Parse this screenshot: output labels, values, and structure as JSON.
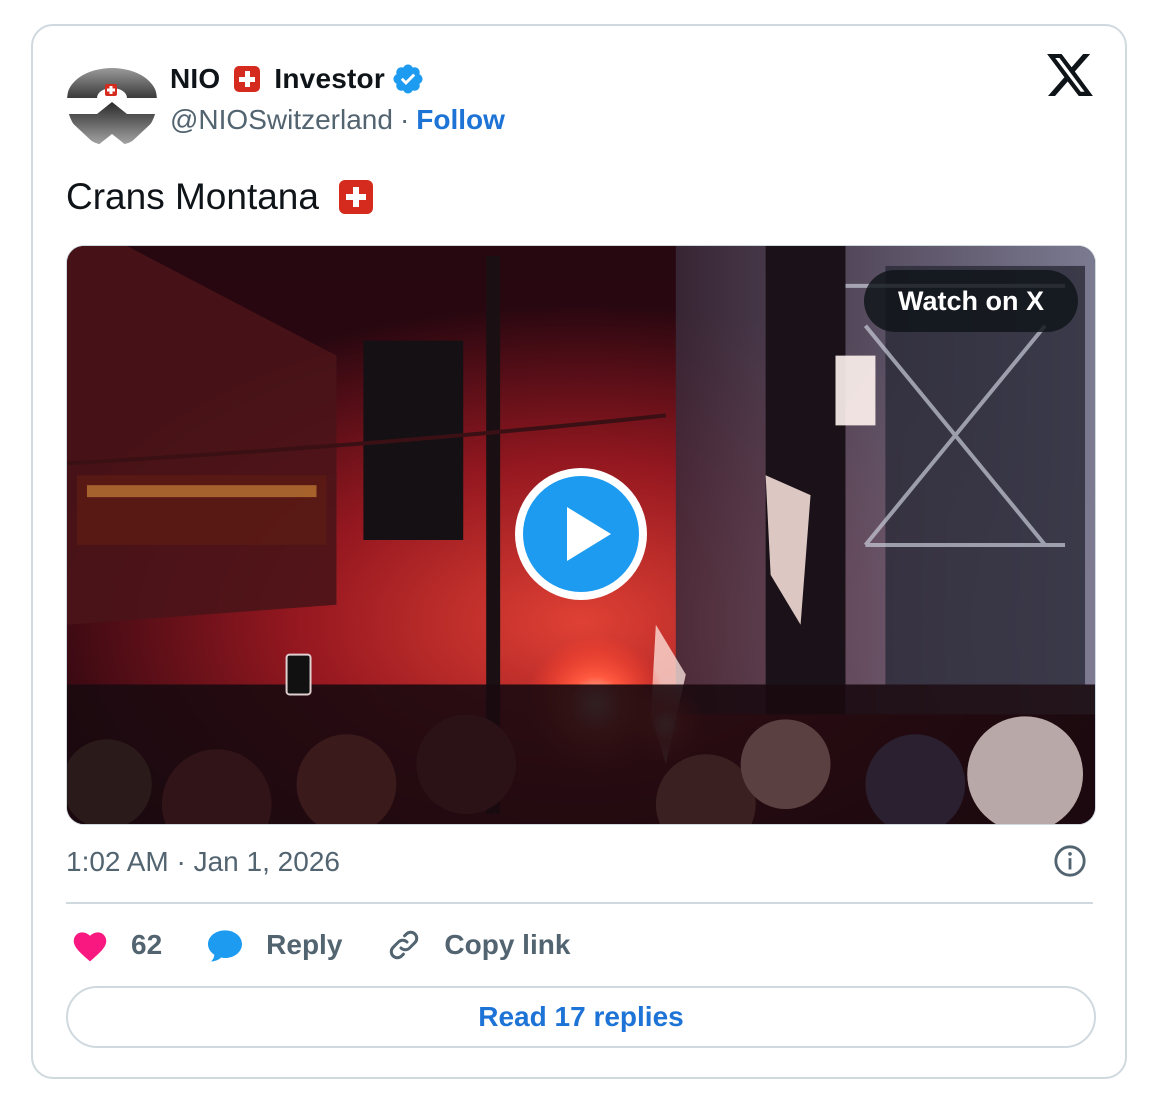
{
  "author": {
    "display_name_part1": "NIO",
    "display_name_part2": "Investor",
    "handle": "@NIOSwitzerland",
    "separator": "·",
    "follow_label": "Follow"
  },
  "tweet": {
    "text": "Crans Montana",
    "timestamp": "1:02 AM · Jan 1, 2026"
  },
  "media": {
    "watch_label": "Watch on X"
  },
  "actions": {
    "likes_count": "62",
    "reply_label": "Reply",
    "copy_link_label": "Copy link"
  },
  "read_replies_label": "Read 17 replies",
  "icons": {
    "brand": "x-logo-icon",
    "verified": "verified-badge-icon",
    "like": "heart-icon",
    "reply": "speech-bubble-icon",
    "copy": "link-icon",
    "info": "info-icon",
    "flag": "swiss-flag-icon",
    "play": "play-icon"
  },
  "colors": {
    "accent": "#1d9bf0",
    "link": "#1d73d6",
    "like": "#f91880",
    "border": "#cfd9de",
    "muted": "#536471",
    "flag": "#d52b1e"
  }
}
